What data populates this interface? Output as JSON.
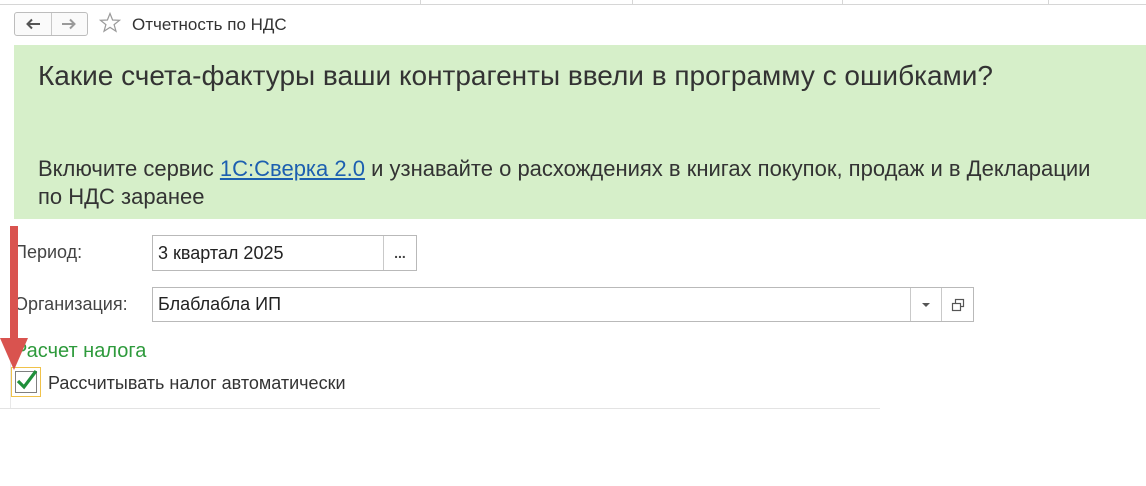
{
  "header": {
    "title": "Отчетность по НДС"
  },
  "banner": {
    "heading": "Какие счета-фактуры ваши контрагенты ввели в программу с ошибками?",
    "text_before": "Включите сервис ",
    "link": "1С:Сверка 2.0",
    "text_after": " и узнавайте о расхождениях в книгах покупок, продаж и в Декларации по НДС заранее",
    "background_color": "#d6efc9",
    "link_color": "#1c5fb0"
  },
  "form": {
    "period_label": "Период:",
    "period_value": "3 квартал 2025",
    "period_button": "...",
    "org_label": "Организация:",
    "org_value": "Блаблабла ИП"
  },
  "tax": {
    "section_title": "Расчет налога",
    "section_color": "#2e9a3c",
    "auto_checkbox_label": "Рассчитывать налог автоматически",
    "auto_checked": true
  },
  "annotation": {
    "arrow_color": "#d9534f"
  }
}
